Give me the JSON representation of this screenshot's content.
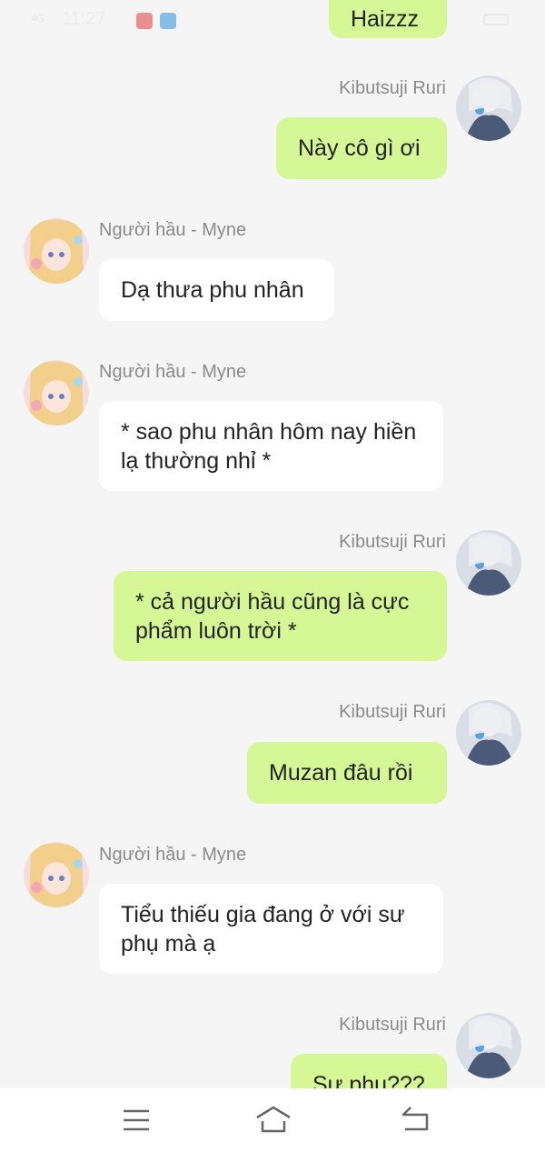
{
  "status_bar": {
    "time": "11:27",
    "signal": "4G"
  },
  "messages": [
    {
      "sender": "Kibutsuji Ruri",
      "side": "right",
      "text": "Haizzz",
      "show_name": false
    },
    {
      "sender": "Kibutsuji Ruri",
      "side": "right",
      "text": "Này cô gì ơi",
      "show_name": true
    },
    {
      "sender": "Người hầu - Myne",
      "side": "left",
      "text": "Dạ thưa phu nhân",
      "show_name": true
    },
    {
      "sender": "Người hầu - Myne",
      "side": "left",
      "text": "* sao phu nhân hôm nay hiền lạ thường nhỉ *",
      "show_name": true
    },
    {
      "sender": "Kibutsuji Ruri",
      "side": "right",
      "text": "* cả người hầu cũng là cực phẩm luôn trời *",
      "show_name": true
    },
    {
      "sender": "Kibutsuji Ruri",
      "side": "right",
      "text": "Muzan đâu rồi",
      "show_name": true
    },
    {
      "sender": "Người hầu - Myne",
      "side": "left",
      "text": "Tiểu thiếu gia đang ở với sư phụ mà ạ",
      "show_name": true
    },
    {
      "sender": "Kibutsuji Ruri",
      "side": "right",
      "text": "Sư phụ???",
      "show_name": true
    }
  ],
  "navbar": {
    "menu_icon": "menu-icon",
    "home_icon": "home-icon",
    "back_icon": "back-icon"
  },
  "colors": {
    "my_bubble": "#d6f795",
    "their_bubble": "#ffffff",
    "background": "#f5f5f5"
  }
}
